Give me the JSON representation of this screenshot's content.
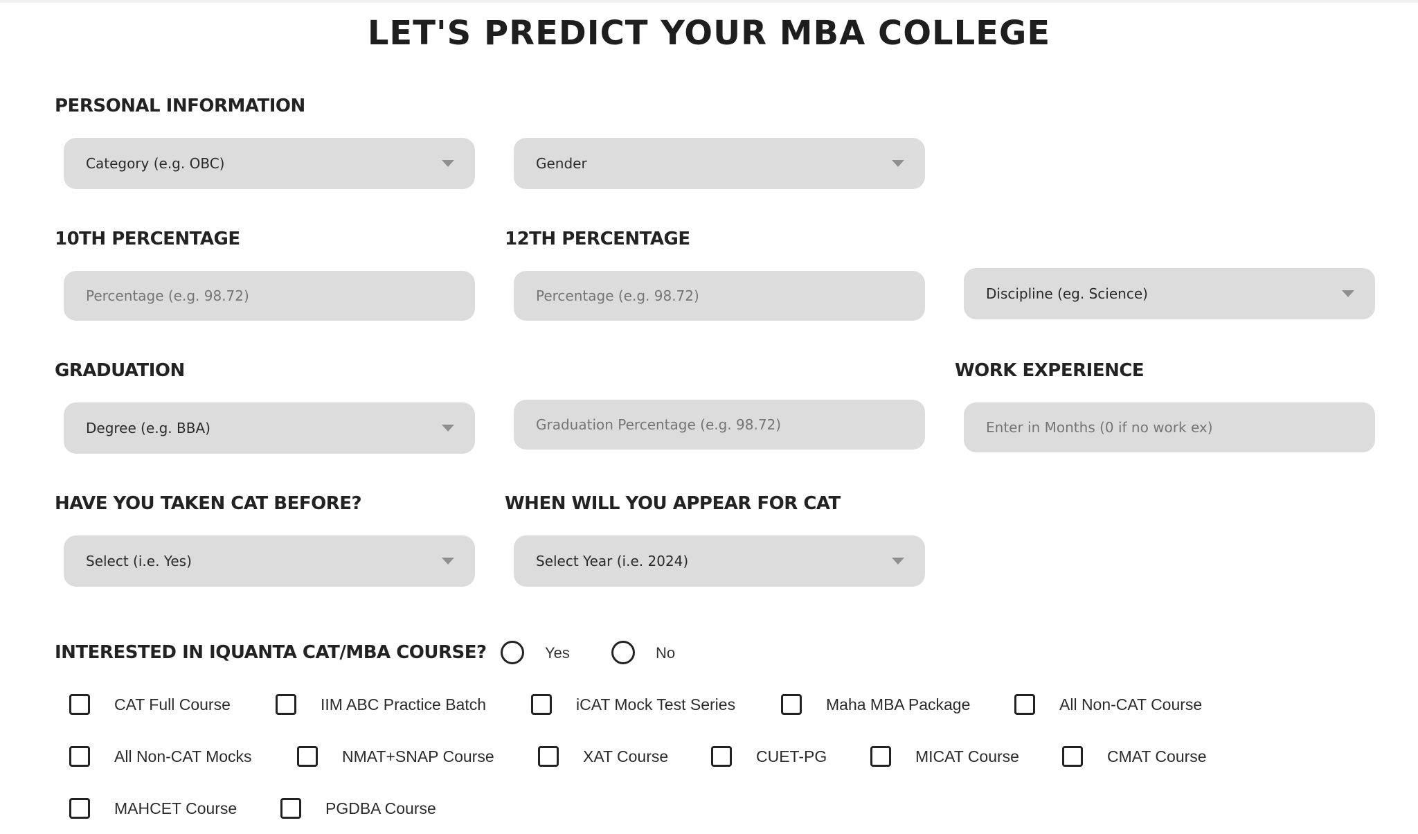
{
  "page": {
    "title": "LET'S PREDICT YOUR MBA COLLEGE"
  },
  "personal_information": {
    "label": "PERSONAL INFORMATION",
    "category": {
      "placeholder": "Category (e.g. OBC)",
      "icon": "chevron-down-icon"
    },
    "gender": {
      "placeholder": "Gender",
      "icon": "chevron-down-icon"
    }
  },
  "tenth": {
    "label": "10TH PERCENTAGE",
    "percentage": {
      "placeholder": "Percentage (e.g. 98.72)",
      "value": ""
    }
  },
  "twelfth": {
    "label": "12TH PERCENTAGE",
    "percentage": {
      "placeholder": "Percentage (e.g. 98.72)",
      "value": ""
    },
    "discipline": {
      "placeholder": "Discipline (eg. Science)",
      "icon": "chevron-down-icon"
    }
  },
  "graduation": {
    "label": "GRADUATION",
    "degree": {
      "placeholder": "Degree (e.g. BBA)",
      "icon": "chevron-down-icon"
    },
    "percentage": {
      "placeholder": "Graduation Percentage (e.g. 98.72)",
      "value": ""
    }
  },
  "work_experience": {
    "label": "WORK EXPERIENCE",
    "months": {
      "placeholder": "Enter in Months (0 if no work ex)",
      "value": ""
    }
  },
  "cat_before": {
    "label": "HAVE YOU TAKEN CAT BEFORE?",
    "select": {
      "placeholder": "Select (i.e. Yes)",
      "icon": "chevron-down-icon"
    }
  },
  "cat_year": {
    "label": "WHEN WILL YOU APPEAR FOR CAT",
    "select": {
      "placeholder": "Select Year (i.e. 2024)",
      "icon": "chevron-down-icon"
    }
  },
  "interest": {
    "label": "INTERESTED IN IQUANTA CAT/MBA COURSE?",
    "options": [
      {
        "label": "Yes",
        "selected": false
      },
      {
        "label": "No",
        "selected": false
      }
    ]
  },
  "courses": [
    {
      "label": "CAT Full Course",
      "checked": false
    },
    {
      "label": "IIM ABC Practice Batch",
      "checked": false
    },
    {
      "label": "iCAT Mock Test Series",
      "checked": false
    },
    {
      "label": "Maha MBA Package",
      "checked": false
    },
    {
      "label": "All Non-CAT Course",
      "checked": false
    },
    {
      "label": "All Non-CAT Mocks",
      "checked": false
    },
    {
      "label": "NMAT+SNAP Course",
      "checked": false
    },
    {
      "label": "XAT Course",
      "checked": false
    },
    {
      "label": "CUET-PG",
      "checked": false
    },
    {
      "label": "MICAT Course",
      "checked": false
    },
    {
      "label": "CMAT Course",
      "checked": false
    },
    {
      "label": "MAHCET Course",
      "checked": false
    },
    {
      "label": "PGDBA Course",
      "checked": false
    }
  ]
}
